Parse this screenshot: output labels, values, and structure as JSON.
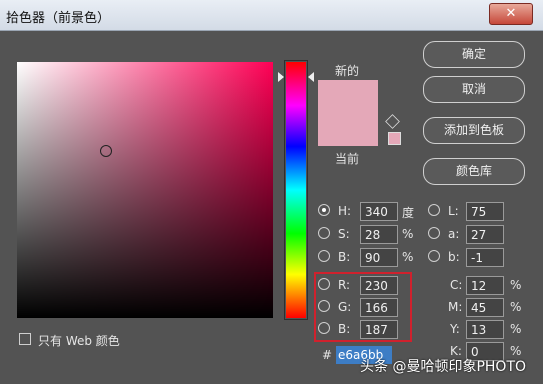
{
  "window": {
    "title": "拾色器（前景色）",
    "close_glyph": "✕"
  },
  "swatch": {
    "new_label": "新的",
    "current_label": "当前",
    "color": "#e4a8b8"
  },
  "buttons": {
    "ok": "确定",
    "cancel": "取消",
    "add_to_swatches": "添加到色板",
    "color_libraries": "颜色库"
  },
  "hsb": {
    "h": {
      "label": "H:",
      "value": "340",
      "unit": "度",
      "selected": true
    },
    "s": {
      "label": "S:",
      "value": "28",
      "unit": "%"
    },
    "b": {
      "label": "B:",
      "value": "90",
      "unit": "%"
    }
  },
  "rgb": {
    "r": {
      "label": "R:",
      "value": "230"
    },
    "g": {
      "label": "G:",
      "value": "166"
    },
    "b": {
      "label": "B:",
      "value": "187"
    }
  },
  "lab": {
    "l": {
      "label": "L:",
      "value": "75"
    },
    "a": {
      "label": "a:",
      "value": "27"
    },
    "b": {
      "label": "b:",
      "value": "-1"
    }
  },
  "cmyk": {
    "c": {
      "label": "C:",
      "value": "12",
      "unit": "%"
    },
    "m": {
      "label": "M:",
      "value": "45",
      "unit": "%"
    },
    "y": {
      "label": "Y:",
      "value": "13",
      "unit": "%"
    },
    "k": {
      "label": "K:",
      "value": "0",
      "unit": "%"
    }
  },
  "hex": {
    "label": "#",
    "value": "e6a6bb"
  },
  "web_only": {
    "label": "只有 Web 颜色"
  },
  "watermark": "头条 @曼哈顿印象PHOTO"
}
